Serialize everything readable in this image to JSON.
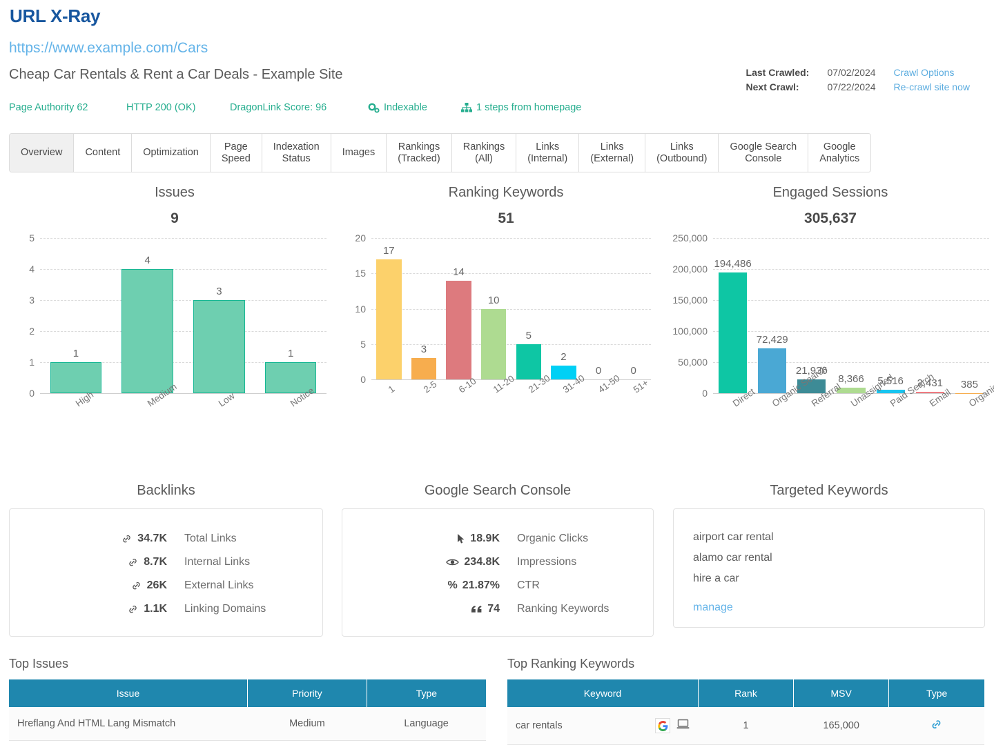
{
  "header": {
    "app_title": "URL X-Ray",
    "url": "https://www.example.com/Cars",
    "page_title": "Cheap Car Rentals & Rent a Car Deals - Example Site",
    "status": {
      "page_authority": "Page Authority 62",
      "http_status": "HTTP 200 (OK)",
      "dragonlink_score": "DragonLink Score: 96",
      "indexable": "Indexable",
      "depth": "1 steps from homepage"
    },
    "crawl": {
      "last_crawled_label": "Last Crawled:",
      "last_crawled_value": "07/02/2024",
      "crawl_options_link": "Crawl Options",
      "next_crawl_label": "Next Crawl:",
      "next_crawl_value": "07/22/2024",
      "recrawl_link": "Re-crawl site now"
    }
  },
  "tabs": [
    {
      "label": "Overview",
      "active": true
    },
    {
      "label": "Content",
      "active": false
    },
    {
      "label": "Optimization",
      "active": false
    },
    {
      "label": "Page\nSpeed",
      "active": false
    },
    {
      "label": "Indexation\nStatus",
      "active": false
    },
    {
      "label": "Images",
      "active": false
    },
    {
      "label": "Rankings\n(Tracked)",
      "active": false
    },
    {
      "label": "Rankings\n(All)",
      "active": false
    },
    {
      "label": "Links\n(Internal)",
      "active": false
    },
    {
      "label": "Links\n(External)",
      "active": false
    },
    {
      "label": "Links\n(Outbound)",
      "active": false
    },
    {
      "label": "Google Search\nConsole",
      "active": false
    },
    {
      "label": "Google\nAnalytics",
      "active": false
    }
  ],
  "chart_data": [
    {
      "type": "bar",
      "title": "Issues",
      "total": "9",
      "categories": [
        "High",
        "Medium",
        "Low",
        "Notice"
      ],
      "values": [
        1,
        4,
        3,
        1
      ],
      "value_labels": [
        "1",
        "4",
        "3",
        "1"
      ],
      "ytick_labels": [
        "0",
        "1",
        "2",
        "3",
        "4",
        "5"
      ],
      "yticks": [
        0,
        1,
        2,
        3,
        4,
        5
      ],
      "ylim": [
        0,
        5
      ],
      "xlabel": "",
      "ylabel": "",
      "grid": true,
      "legend": "none",
      "colors": [
        "#6ecfb0",
        "#6ecfb0",
        "#6ecfb0",
        "#6ecfb0"
      ],
      "border_colors": [
        "#17b794",
        "#17b794",
        "#17b794",
        "#17b794"
      ]
    },
    {
      "type": "bar",
      "title": "Ranking Keywords",
      "total": "51",
      "categories": [
        "1",
        "2-5",
        "6-10",
        "11-20",
        "21-30",
        "31-40",
        "41-50",
        "51+"
      ],
      "values": [
        17,
        3,
        14,
        10,
        5,
        2,
        0,
        0
      ],
      "value_labels": [
        "17",
        "3",
        "14",
        "10",
        "5",
        "2",
        "0",
        "0"
      ],
      "ytick_labels": [
        "0",
        "5",
        "10",
        "15",
        "20"
      ],
      "yticks": [
        0,
        5,
        10,
        15,
        20
      ],
      "ylim": [
        0,
        20
      ],
      "xlabel": "",
      "ylabel": "",
      "grid": true,
      "legend": "none",
      "colors": [
        "#fcd16b",
        "#f7ad4e",
        "#dd7a7e",
        "#aedb91",
        "#0ec6a4",
        "#00d0f5",
        "#ffffff",
        "#ffffff"
      ],
      "border_colors": [
        "#fcd16b",
        "#f7ad4e",
        "#dd7a7e",
        "#aedb91",
        "#0ec6a4",
        "#00d0f5",
        "#ffffff",
        "#ffffff"
      ]
    },
    {
      "type": "bar",
      "title": "Engaged Sessions",
      "total": "305,637",
      "categories": [
        "Direct",
        "Organic Search",
        "Referral",
        "Unassigned",
        "Paid Search",
        "Email",
        "Organic Social"
      ],
      "values": [
        194486,
        72429,
        21936,
        8366,
        5516,
        2431,
        385
      ],
      "value_labels": [
        "194,486",
        "72,429",
        "21,936",
        "8,366",
        "5,516",
        "2,431",
        "385"
      ],
      "ytick_labels": [
        "0",
        "50,000",
        "100,000",
        "150,000",
        "200,000",
        "250,000"
      ],
      "yticks": [
        0,
        50000,
        100000,
        150000,
        200000,
        250000
      ],
      "ylim": [
        0,
        250000
      ],
      "xlabel": "",
      "ylabel": "",
      "grid": true,
      "legend": "none",
      "colors": [
        "#0ec6a4",
        "#4aa8d4",
        "#3d8b96",
        "#aedb91",
        "#18c5f0",
        "#ee7a80",
        "#f7ad4e"
      ],
      "border_colors": [
        "#0ec6a4",
        "#4aa8d4",
        "#3d8b96",
        "#aedb91",
        "#18c5f0",
        "#ee7a80",
        "#f7ad4e"
      ]
    }
  ],
  "backlinks": {
    "title": "Backlinks",
    "rows": [
      {
        "icon": "link-icon",
        "value": "34.7K",
        "label": "Total Links"
      },
      {
        "icon": "link-icon",
        "value": "8.7K",
        "label": "Internal Links"
      },
      {
        "icon": "link-icon",
        "value": "26K",
        "label": "External Links"
      },
      {
        "icon": "link-icon",
        "value": "1.1K",
        "label": "Linking Domains"
      }
    ]
  },
  "gsc": {
    "title": "Google Search Console",
    "rows": [
      {
        "icon": "cursor-icon",
        "value": "18.9K",
        "label": "Organic Clicks"
      },
      {
        "icon": "eye-icon",
        "value": "234.8K",
        "label": "Impressions"
      },
      {
        "icon": "percent-icon",
        "value": "21.87%",
        "label": "CTR"
      },
      {
        "icon": "quote-icon",
        "value": "74",
        "label": "Ranking Keywords"
      }
    ]
  },
  "targeted_keywords": {
    "title": "Targeted Keywords",
    "items": [
      "airport car rental",
      "alamo car rental",
      "hire a car"
    ],
    "manage_link": "manage"
  },
  "top_issues": {
    "caption": "Top Issues",
    "columns": [
      "Issue",
      "Priority",
      "Type"
    ],
    "rows": [
      {
        "issue": "Hreflang And HTML Lang Mismatch",
        "priority": "Medium",
        "type": "Language"
      }
    ]
  },
  "top_ranking_keywords": {
    "caption": "Top Ranking Keywords",
    "columns": [
      "Keyword",
      "Rank",
      "MSV",
      "Type"
    ],
    "rows": [
      {
        "keyword": "car rentals",
        "rank": "1",
        "msv": "165,000",
        "type_icon": "link-icon"
      }
    ]
  },
  "colors": {
    "brand_title": "#18579f",
    "link": "#63b3e8",
    "status_green": "#27ae8f",
    "table_header": "#1f87ae"
  }
}
